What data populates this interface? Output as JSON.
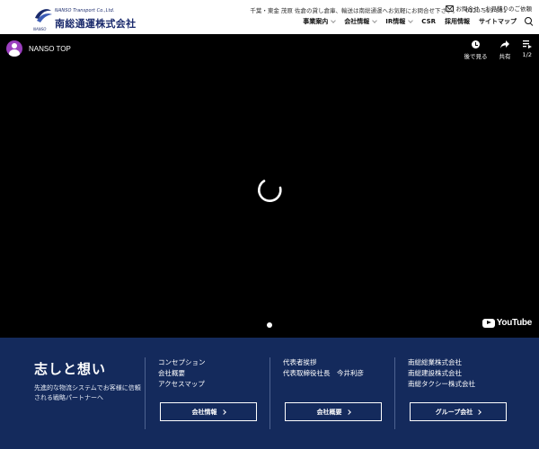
{
  "header": {
    "logo": {
      "sub": "NANSO Transport Co.,Ltd.",
      "name": "南総通運株式会社",
      "mark_text": "NANSO"
    },
    "topline": {
      "text": "千葉・東金 茂原 佐倉の貸し倉庫、輸送は南総通運へお気軽にお問合せ下さい。",
      "tel": "0120-513-581"
    },
    "inquiry_label": "お問合せ・お見積りのご依頼",
    "nav": [
      {
        "label": "事業案内",
        "dropdown": true
      },
      {
        "label": "会社情報",
        "dropdown": true
      },
      {
        "label": "IR情報",
        "dropdown": true
      },
      {
        "label": "CSR",
        "dropdown": false
      },
      {
        "label": "採用情報",
        "dropdown": false
      },
      {
        "label": "サイトマップ",
        "dropdown": false
      }
    ]
  },
  "video": {
    "channel_title": "NANSO TOP",
    "controls": [
      {
        "icon": "clock-icon",
        "label": "後で見る"
      },
      {
        "icon": "share-icon",
        "label": "共有"
      },
      {
        "icon": "playlist-icon",
        "label": "1/2"
      }
    ],
    "brand": "YouTube"
  },
  "band": {
    "title": "志しと想い",
    "text": "先進的な物流システムでお客様に信頼される戦略パートナーへ",
    "columns": [
      {
        "links": [
          "コンセプション",
          "会社概要",
          "アクセスマップ"
        ],
        "button": "会社情報"
      },
      {
        "links": [
          "代表者挨拶",
          "代表取締役社長　今井利彦"
        ],
        "button": "会社概要"
      },
      {
        "links": [
          "南総総業株式会社",
          "南総建設株式会社",
          "南総タクシー株式会社"
        ],
        "button": "グループ会社"
      }
    ]
  },
  "colors": {
    "band_bg": "#142a5c",
    "brand_navy": "#1a2a6c",
    "avatar": "#9b3fbf"
  }
}
